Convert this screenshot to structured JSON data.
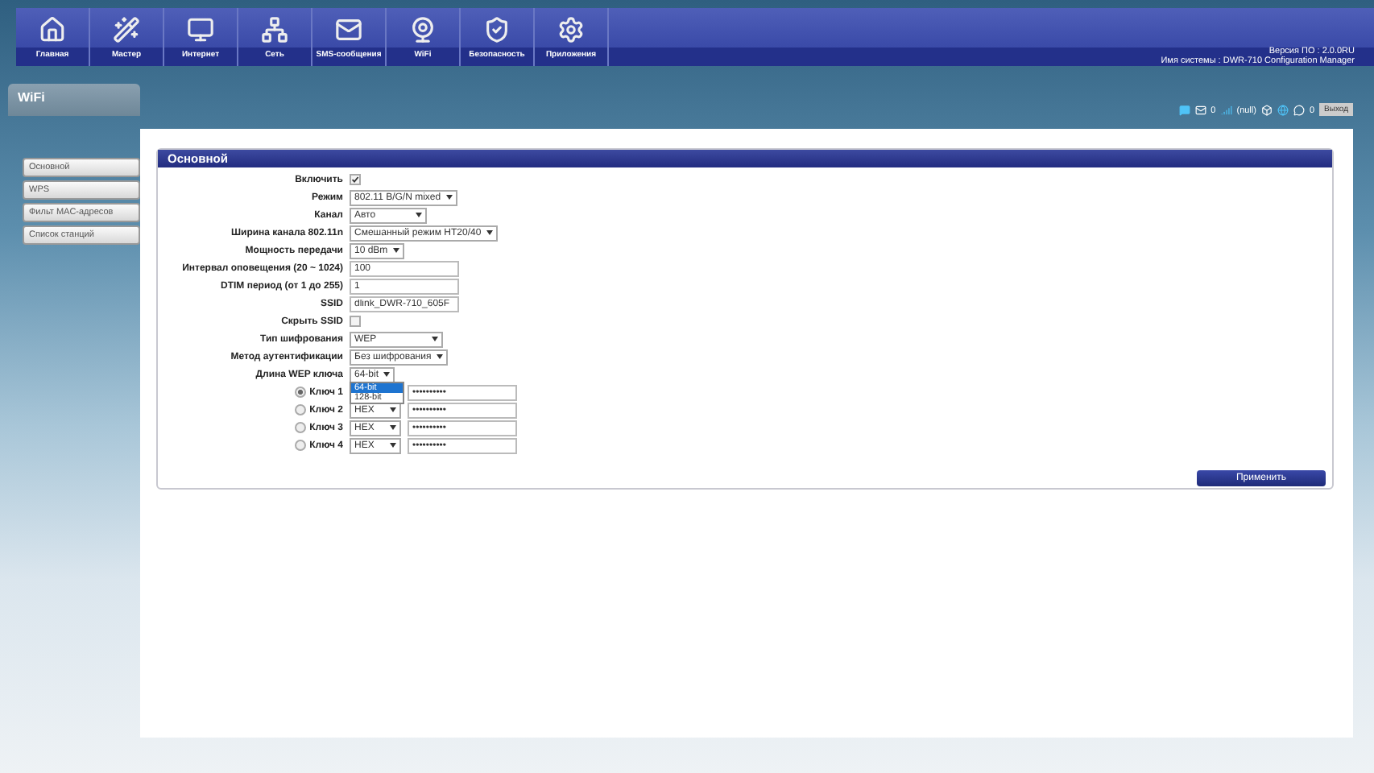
{
  "nav": {
    "items": [
      {
        "label": "Главная"
      },
      {
        "label": "Мастер"
      },
      {
        "label": "Интернет"
      },
      {
        "label": "Сеть"
      },
      {
        "label": "SMS-сообщения"
      },
      {
        "label": "WiFi"
      },
      {
        "label": "Безопасность"
      },
      {
        "label": "Приложения"
      }
    ],
    "firmware": "Версия ПО : 2.0.0RU",
    "system_name": "Имя системы : DWR-710 Configuration Manager"
  },
  "page_title": "WiFi",
  "sidebar": {
    "items": [
      {
        "label": "Основной"
      },
      {
        "label": "WPS"
      },
      {
        "label": "Фильт MAC-адресов"
      },
      {
        "label": "Список станций"
      }
    ]
  },
  "status": {
    "mail_count": "0",
    "signal": "(null)",
    "message_count": "0",
    "logout": "Выход"
  },
  "section": {
    "title": "Основной",
    "fields": [
      {
        "kind": "checkbox",
        "label": "Включить",
        "checked": true
      },
      {
        "kind": "select",
        "label": "Режим",
        "value": "802.11 B/G/N mixed"
      },
      {
        "kind": "select",
        "label": "Канал",
        "value": "Авто"
      },
      {
        "kind": "select",
        "label": "Ширина канала 802.11n",
        "value": "Смешанный режим HT20/40"
      },
      {
        "kind": "select",
        "label": "Мощность передачи",
        "value": "10 dBm"
      },
      {
        "kind": "text",
        "label": "Интервал оповещения (20 ~ 1024)",
        "value": "100"
      },
      {
        "kind": "text",
        "label": "DTIM период (от 1 до 255)",
        "value": "1"
      },
      {
        "kind": "text",
        "label": "SSID",
        "value": "dlink_DWR-710_605F"
      },
      {
        "kind": "checkbox",
        "label": "Скрыть SSID",
        "checked": false
      },
      {
        "kind": "select",
        "label": "Тип шифрования",
        "value": "WEP"
      },
      {
        "kind": "select",
        "label": "Метод аутентификации",
        "value": "Без шифрования"
      },
      {
        "kind": "select",
        "label": "Длина WEP ключа",
        "value": "64-bit",
        "open": true,
        "options": [
          {
            "label": "64-bit",
            "selected": true
          },
          {
            "label": "128-bit",
            "selected": false
          }
        ]
      }
    ],
    "keys": [
      {
        "label": "Ключ 1",
        "selected": true,
        "value": "••••••••••"
      },
      {
        "label": "Ключ 2",
        "selected": false,
        "format": "HEX",
        "value": "••••••••••"
      },
      {
        "label": "Ключ 3",
        "selected": false,
        "format": "HEX",
        "value": "••••••••••"
      },
      {
        "label": "Ключ 4",
        "selected": false,
        "format": "HEX",
        "value": "••••••••••"
      }
    ],
    "apply": "Применить"
  }
}
